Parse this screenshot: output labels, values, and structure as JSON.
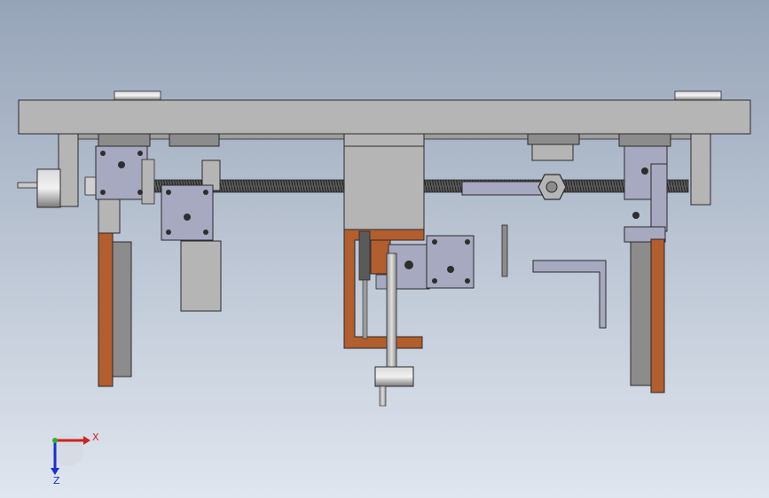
{
  "triad": {
    "x_label": "X",
    "z_label": "Z",
    "x_color": "#d32020",
    "z_color": "#1c2fd0",
    "origin_color": "#28b428"
  },
  "colors": {
    "bg_top": "#96a4b8",
    "bg_bottom": "#e0e6ef",
    "part_gray": "#b5b5b5",
    "part_dark": "#8c8c8c",
    "plate_blue": "#a7a9c0",
    "copper": "#b25e2e",
    "edge": "#2a2a2a",
    "screw_dark": "#2e2e2e"
  }
}
